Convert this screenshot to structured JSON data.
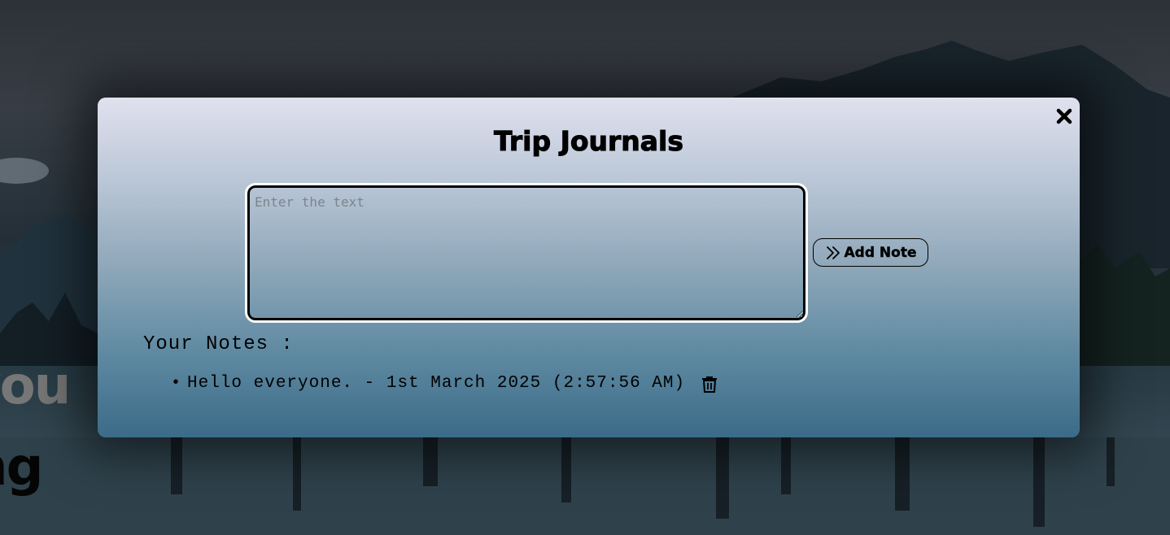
{
  "background": {
    "heading_line1": "you",
    "heading_line2": "ng"
  },
  "modal": {
    "title": "Trip Journals",
    "close_icon": "close-icon",
    "input": {
      "placeholder": "Enter the text",
      "value": ""
    },
    "add_button": {
      "label": "Add Note",
      "icon": "double-chevron-right-icon"
    },
    "notes_heading": "Your Notes :",
    "notes": [
      {
        "text": "Hello everyone. - 1st March 2025 (2:57:56 AM)",
        "delete_icon": "trash-icon"
      }
    ]
  },
  "colors": {
    "modal_top": "#e1e1ee",
    "modal_bottom": "#3b6b88",
    "text": "#000000"
  }
}
